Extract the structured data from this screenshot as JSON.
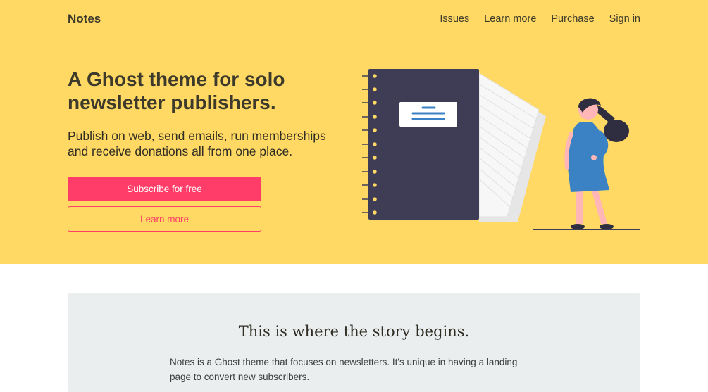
{
  "header": {
    "logo": "Notes",
    "nav": [
      "Issues",
      "Learn more",
      "Purchase",
      "Sign in"
    ]
  },
  "hero": {
    "headline": "A Ghost theme for solo newsletter publishers.",
    "subline": "Publish on web, send emails, run memberships and receive donations all from one place.",
    "subscribe_label": "Subscribe for free",
    "learn_more_label": "Learn more"
  },
  "story": {
    "title": "This is where the story begins.",
    "body": "Notes is a Ghost theme that focuses on newsletters. It's unique in having a landing page to convert new subscribers."
  },
  "colors": {
    "hero_bg": "#ffd963",
    "accent": "#ff3d68",
    "notebook": "#3f3d56",
    "story_bg": "#ebeeef"
  }
}
